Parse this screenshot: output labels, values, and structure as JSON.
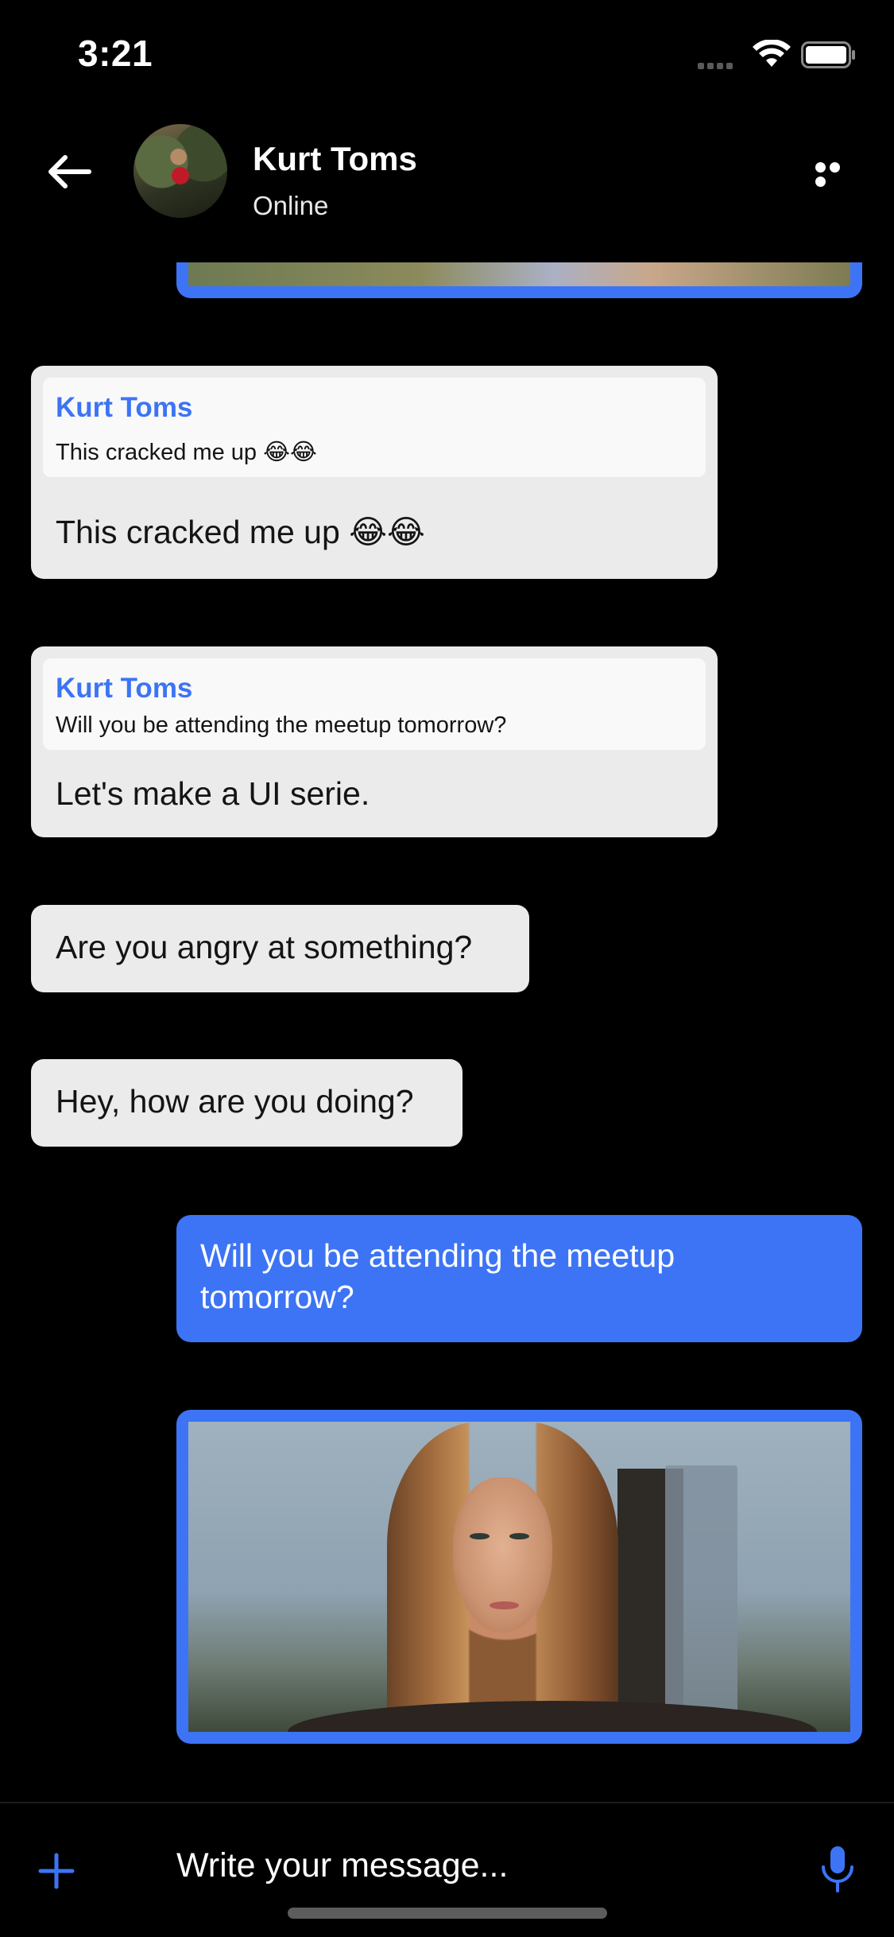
{
  "status_bar": {
    "time": "3:21"
  },
  "header": {
    "contact_name": "Kurt Toms",
    "contact_status": "Online"
  },
  "messages": [
    {
      "type": "image",
      "direction": "sent",
      "alt": ""
    },
    {
      "type": "reply",
      "direction": "received",
      "quoted_name": "Kurt Toms",
      "quoted_text": "This cracked me up 😂😂",
      "text": "This cracked me up 😂😂"
    },
    {
      "type": "reply",
      "direction": "received",
      "quoted_name": "Kurt Toms",
      "quoted_text": "Will you be attending the meetup tomorrow?",
      "text": "Let's make a UI serie."
    },
    {
      "type": "text",
      "direction": "received",
      "text": "Are you angry at something?"
    },
    {
      "type": "text",
      "direction": "received",
      "text": "Hey, how are you doing?"
    },
    {
      "type": "text",
      "direction": "sent",
      "text_line1": "Will you be attending the meetup",
      "text_line2": "tomorrow?"
    },
    {
      "type": "image",
      "direction": "sent",
      "alt": ""
    }
  ],
  "composer": {
    "placeholder": "Write your message..."
  },
  "colors": {
    "accent": "#3d74f5",
    "received_bubble": "#ebebeb",
    "background": "#000000"
  },
  "icons": [
    "back-arrow-icon",
    "more-icon",
    "plus-icon",
    "microphone-icon",
    "wifi-icon",
    "battery-icon",
    "cellular-signal-icon"
  ]
}
